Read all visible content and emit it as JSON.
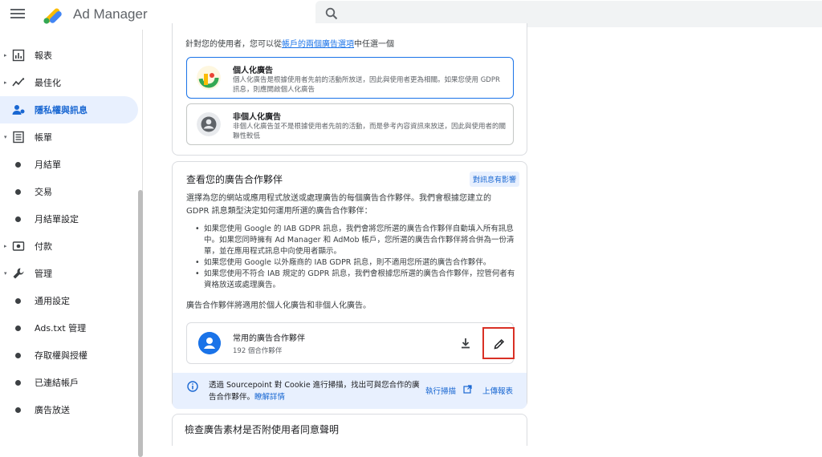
{
  "app": {
    "title": "Ad Manager"
  },
  "sidebar": {
    "items": [
      {
        "label": "報表",
        "caret": "▸"
      },
      {
        "label": "最佳化",
        "caret": "▸"
      },
      {
        "label": "隱私權與訊息",
        "caret": ""
      },
      {
        "label": "帳單",
        "caret": "▾"
      },
      {
        "label": "月結單"
      },
      {
        "label": "交易"
      },
      {
        "label": "月結單設定"
      },
      {
        "label": "付款",
        "caret": "▸"
      },
      {
        "label": "管理",
        "caret": "▾"
      },
      {
        "label": "通用設定"
      },
      {
        "label": "Ads.txt 管理"
      },
      {
        "label": "存取權與授權"
      },
      {
        "label": "已連結帳戶"
      },
      {
        "label": "廣告放送"
      }
    ]
  },
  "ad_options": {
    "intro_prefix": "針對您的使用者，您可以從",
    "intro_link": "帳戶的兩個廣告選項",
    "intro_suffix": "中任選一個",
    "personalized": {
      "title": "個人化廣告",
      "desc": "個人化廣告是根據使用者先前的活動所放送，因此與使用者更為相關。如果您使用 GDPR 訊息，則應開啟個人化廣告"
    },
    "non_personalized": {
      "title": "非個人化廣告",
      "desc": "非個人化廣告並不是根據使用者先前的活動，而是參考內容資訊來放送，因此與使用者的關聯性較低"
    }
  },
  "partners": {
    "title": "查看您的廣告合作夥伴",
    "badge": "對訊息有影響",
    "desc": "選擇為您的網站或應用程式放送或處理廣告的每個廣告合作夥伴。我們會根據您建立的 GDPR 訊息類型決定如何運用所選的廣告合作夥伴：",
    "bullets": [
      "如果您使用 Google 的 IAB GDPR 訊息，我們會將您所選的廣告合作夥伴自動填入所有訊息中。如果您同時擁有 Ad Manager 和 AdMob 帳戶，您所選的廣告合作夥伴將合併為一份清單，並在應用程式訊息中向使用者顯示。",
      "如果您使用 Google 以外廠商的 IAB GDPR 訊息，則不適用您所選的廣告合作夥伴。",
      "如果您使用不符合 IAB 規定的 GDPR 訊息，我們會根據您所選的廣告合作夥伴，控管何者有資格放送或處理廣告。"
    ],
    "applies_note": "廣告合作夥伴將適用於個人化廣告和非個人化廣告。",
    "list_title": "常用的廣告合作夥伴",
    "list_count": "192 個合作夥伴",
    "info_text": "透過 Sourcepoint 對 Cookie 進行掃描，找出可與您合作的廣告合作夥伴。",
    "info_link": "瞭解詳情",
    "scan_label": "執行掃描",
    "upload_label": "上傳報表"
  },
  "next_card": {
    "title": "檢查廣告素材是否附使用者同意聲明"
  },
  "colors": {
    "accent": "#1a73e8",
    "highlight_border": "#d93025"
  }
}
